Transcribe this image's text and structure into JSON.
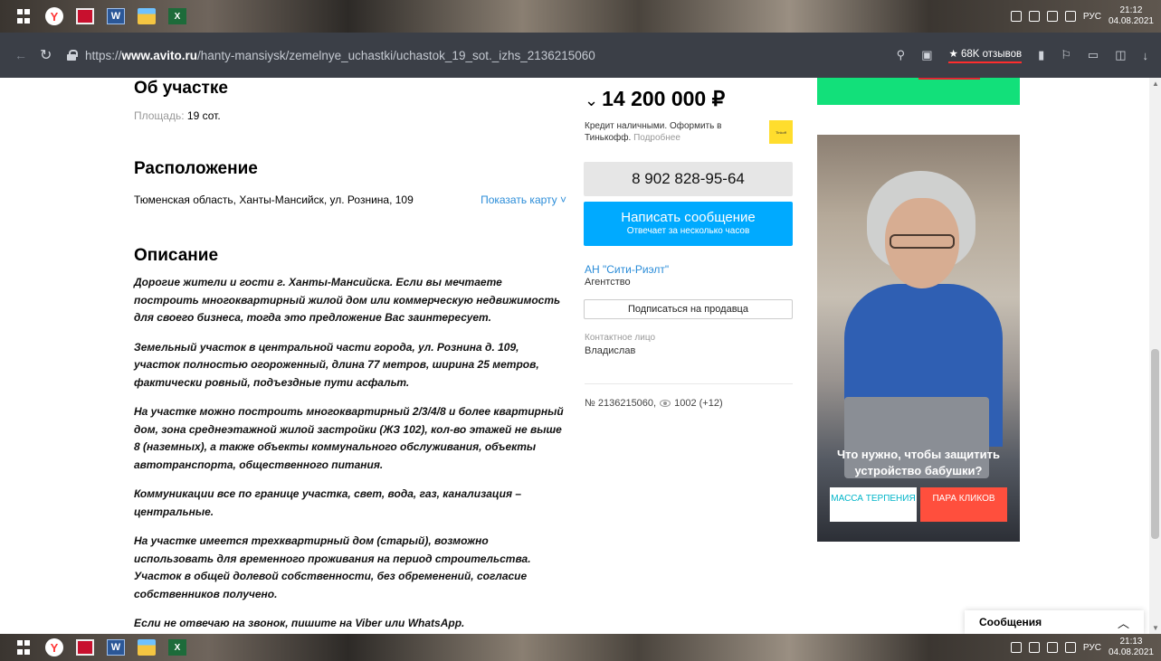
{
  "taskbar": {
    "icons": [
      "windows-start-icon",
      "yandex-browser-icon",
      "red-app-icon",
      "word-icon",
      "file-explorer-icon",
      "excel-icon"
    ],
    "lang": "РУС",
    "time_top": "21:12",
    "date_top": "04.08.2021",
    "time_bottom": "21:13",
    "date_bottom": "04.08.2021"
  },
  "browser": {
    "url_prefix": "https://",
    "url_domain": "www.avito.ru",
    "url_path": "/hanty-mansiysk/zemelnye_uchastki/uchastok_19_sot._izhs_2136215060",
    "reviews": "★ 68K отзывов"
  },
  "about": {
    "title": "Об участке",
    "area_label": "Площадь:",
    "area_value": "19 сот."
  },
  "location": {
    "title": "Расположение",
    "address": "Тюменская область, Ханты-Мансийск, ул. Рознина, 109",
    "map_link": "Показать карту ˅"
  },
  "description": {
    "title": "Описание",
    "paragraphs": [
      "Дорогие жители и гости г. Ханты-Мансийска. Если вы мечтаете построить многоквартирный жилой дом или коммерческую недвижимость для своего бизнеса, тогда это предложение Вас заинтересует.",
      "Земельный участок в центральной части города, ул. Рознина д. 109, участок полностью огороженный, длина 77 метров, ширина 25 метров, фактически ровный, подъездные пути асфальт.",
      "На участке можно построить многоквартирный 2/3/4/8 и более квартирный дом, зона среднеэтажной жилой застройки (ЖЗ 102), кол-во этажей не выше 8 (наземных), а также объекты коммунального обслуживания, объекты автотранспорта, общественного питания.",
      "Коммуникации все по границе участка, свет, вода, газ, канализация – центральные.",
      "На участке имеется трехквартирный дом (старый), возможно использовать для временного проживания на период строительства. Участок в общей долевой собственности, без обременений, согласие собственников получено.",
      "Если не отвечаю на звонок, пишите на Viber или WhatsApp."
    ]
  },
  "sidebar": {
    "price": "14 200 000 ₽",
    "credit_text": "Кредит наличными. Оформить в Тинькофф.",
    "credit_more": "Подробнее",
    "phone": "8 902 828-95-64",
    "message_button": "Написать сообщение",
    "message_subtitle": "Отвечает за несколько часов",
    "seller_name": "АН \"Сити-Риэлт\"",
    "seller_type": "Агентство",
    "subscribe_button": "Подписаться на продавца",
    "contact_label": "Контактное лицо",
    "contact_name": "Владислав",
    "ad_number": "№ 2136215060,",
    "views": "1002 (+12)"
  },
  "ad": {
    "title": "Что нужно, чтобы защитить устройство бабушки?",
    "button_left": "МАССА ТЕРПЕНИЯ",
    "button_right": "ПАРА КЛИКОВ"
  },
  "messages_widget": {
    "label": "Сообщения"
  }
}
